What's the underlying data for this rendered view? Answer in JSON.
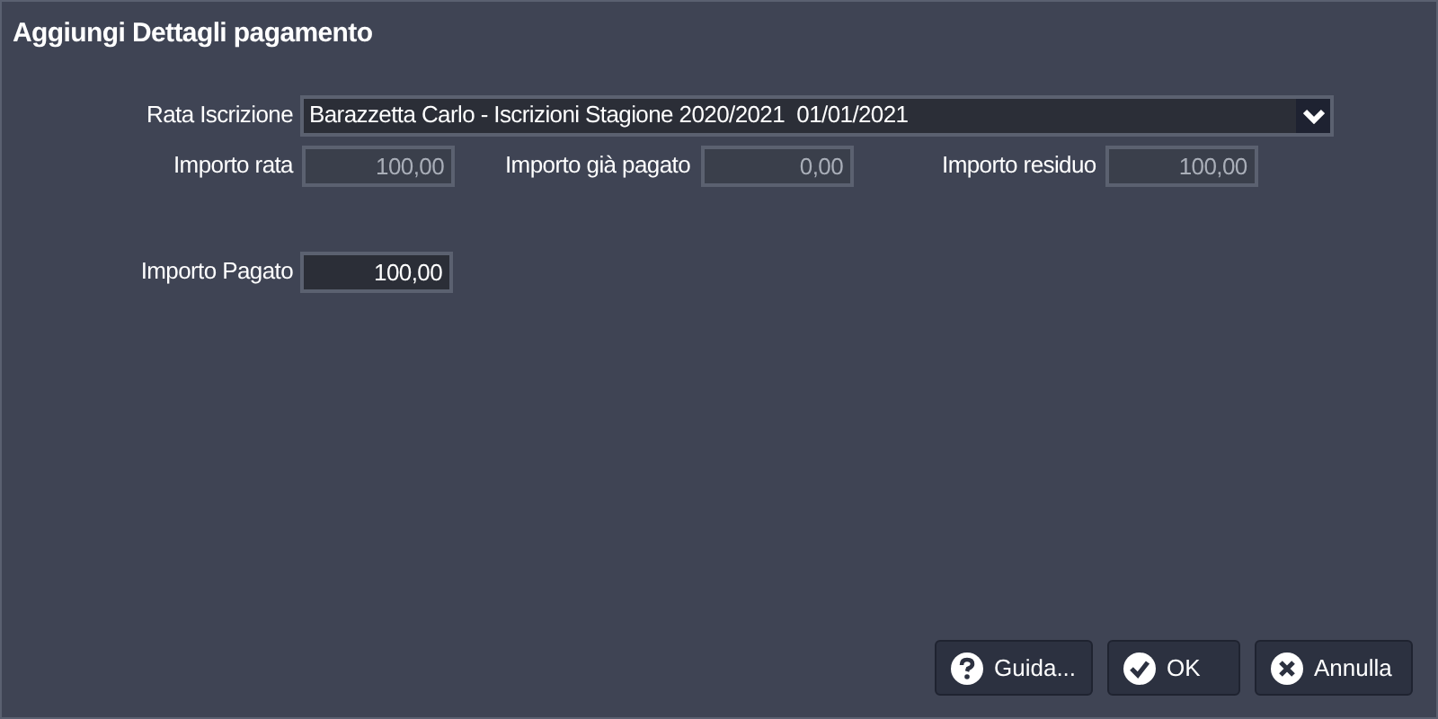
{
  "window": {
    "title": "Aggiungi Dettagli pagamento"
  },
  "rata": {
    "label": "Rata Iscrizione",
    "value": "Barazzetta Carlo - Iscrizioni Stagione 2020/2021  01/01/2021"
  },
  "amounts": [
    {
      "label": "Importo rata",
      "value": "100,00",
      "disabled": true
    },
    {
      "label": "Importo già pagato",
      "value": "0,00",
      "disabled": true
    },
    {
      "label": "Importo residuo",
      "value": "100,00",
      "disabled": true
    }
  ],
  "paid": {
    "label": "Importo Pagato",
    "value": "100,00",
    "disabled": false
  },
  "buttons": [
    {
      "kind": "help",
      "label": "Guida..."
    },
    {
      "kind": "ok",
      "label": "OK"
    },
    {
      "kind": "cancel",
      "label": "Annulla"
    }
  ]
}
